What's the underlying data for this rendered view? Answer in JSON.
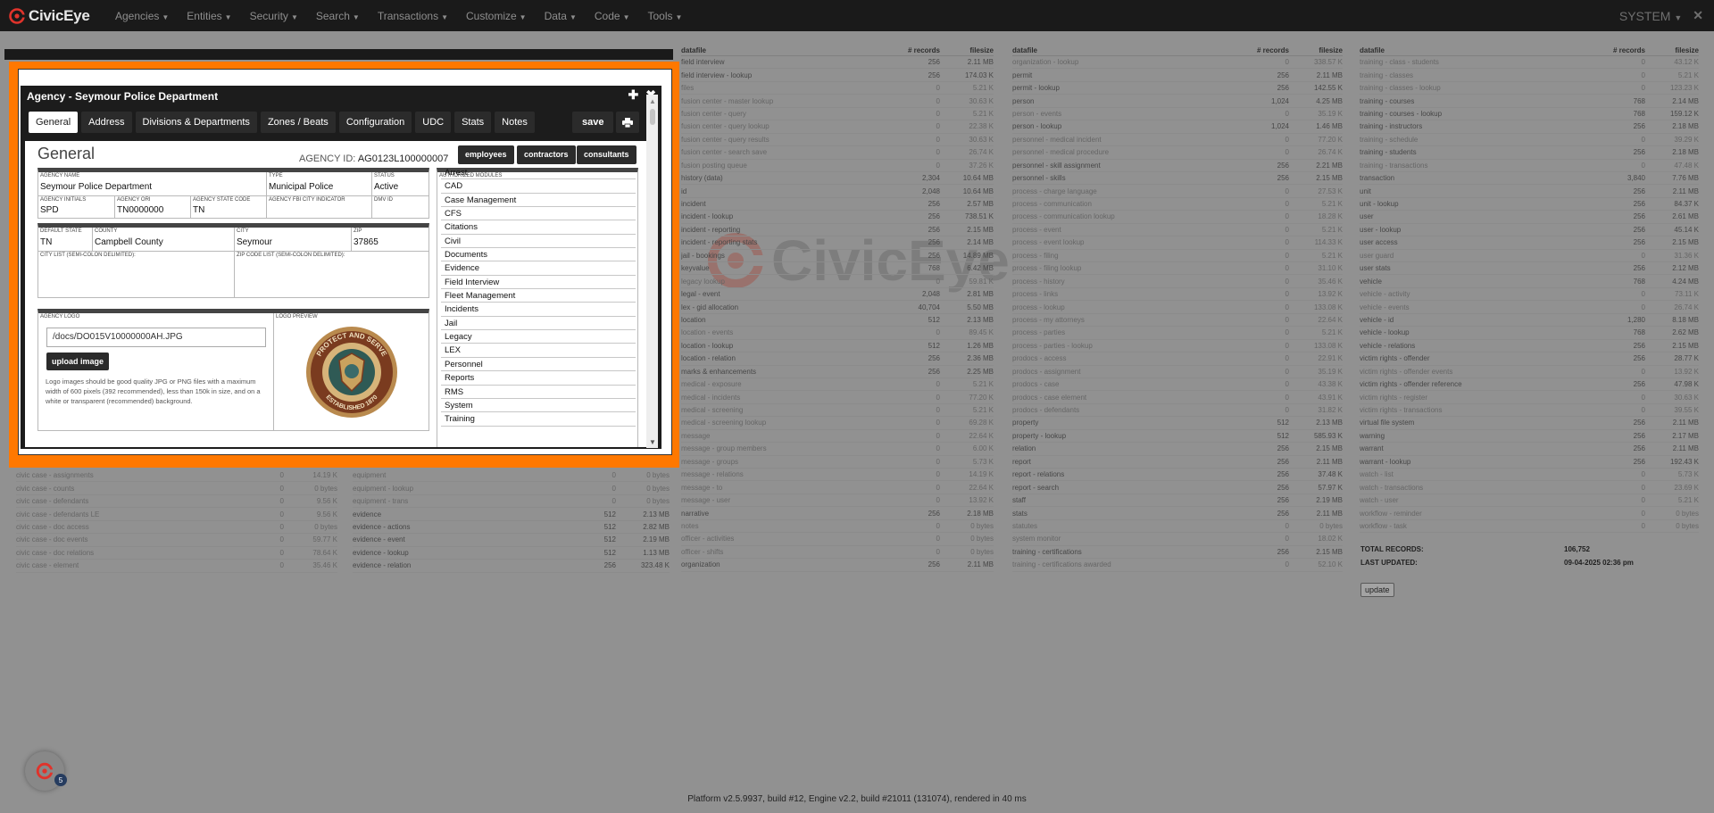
{
  "app": {
    "name": "CivicEye",
    "user": "SYSTEM",
    "brand_color": "#e0332b"
  },
  "menu": [
    "Agencies",
    "Entities",
    "Security",
    "Search",
    "Transactions",
    "Customize",
    "Data",
    "Code",
    "Tools"
  ],
  "bg_headers": {
    "datafile": "datafile",
    "records": "# records",
    "filesize": "filesize"
  },
  "bg_col1": [
    [
      "field interview",
      "256",
      "2.11 MB"
    ],
    [
      "field interview - lookup",
      "256",
      "174.03 K"
    ],
    [
      "files",
      "0",
      "5.21 K"
    ],
    [
      "fusion center - master lookup",
      "0",
      "30.63 K"
    ],
    [
      "fusion center - query",
      "0",
      "5.21 K"
    ],
    [
      "fusion center - query lookup",
      "0",
      "22.38 K"
    ],
    [
      "fusion center - query results",
      "0",
      "30.63 K"
    ],
    [
      "fusion center - search save",
      "0",
      "26.74 K"
    ],
    [
      "fusion posting queue",
      "0",
      "37.26 K"
    ],
    [
      "history (data)",
      "2,304",
      "10.64 MB"
    ],
    [
      "id",
      "2,048",
      "10.64 MB"
    ],
    [
      "incident",
      "256",
      "2.57 MB"
    ],
    [
      "incident - lookup",
      "256",
      "738.51 K"
    ],
    [
      "incident - reporting",
      "256",
      "2.15 MB"
    ],
    [
      "incident - reporting stats",
      "256",
      "2.14 MB"
    ],
    [
      "jail - bookings",
      "256",
      "14.89 MB"
    ],
    [
      "keyvalue",
      "768",
      "6.42 MB"
    ],
    [
      "legacy lookup",
      "0",
      "59.81 K"
    ],
    [
      "legal - event",
      "2,048",
      "2.81 MB"
    ],
    [
      "lex - gid allocation",
      "40,704",
      "5.50 MB"
    ],
    [
      "location",
      "512",
      "2.13 MB"
    ],
    [
      "location - events",
      "0",
      "89.45 K"
    ],
    [
      "location - lookup",
      "512",
      "1.26 MB"
    ],
    [
      "location - relation",
      "256",
      "2.36 MB"
    ],
    [
      "marks & enhancements",
      "256",
      "2.25 MB"
    ],
    [
      "medical - exposure",
      "0",
      "5.21 K"
    ],
    [
      "medical - incidents",
      "0",
      "77.20 K"
    ],
    [
      "medical - screening",
      "0",
      "5.21 K"
    ],
    [
      "medical - screening lookup",
      "0",
      "69.28 K"
    ],
    [
      "message",
      "0",
      "22.64 K"
    ],
    [
      "message - group members",
      "0",
      "6.00 K"
    ],
    [
      "message - groups",
      "0",
      "5.73 K"
    ],
    [
      "message - relations",
      "0",
      "14.19 K"
    ],
    [
      "message - to",
      "0",
      "22.64 K"
    ],
    [
      "message - user",
      "0",
      "13.92 K"
    ],
    [
      "narrative",
      "256",
      "2.18 MB"
    ],
    [
      "notes",
      "0",
      "0 bytes"
    ],
    [
      "officer - activities",
      "0",
      "0 bytes"
    ],
    [
      "officer - shifts",
      "0",
      "0 bytes"
    ],
    [
      "organization",
      "256",
      "2.11 MB"
    ]
  ],
  "bg_col2": [
    [
      "organization - lookup",
      "0",
      "338.57 K"
    ],
    [
      "permit",
      "256",
      "2.11 MB"
    ],
    [
      "permit - lookup",
      "256",
      "142.55 K"
    ],
    [
      "person",
      "1,024",
      "4.25 MB"
    ],
    [
      "person - events",
      "0",
      "35.19 K"
    ],
    [
      "person - lookup",
      "1,024",
      "1.46 MB"
    ],
    [
      "personnel - medical incident",
      "0",
      "77.20 K"
    ],
    [
      "personnel - medical procedure",
      "0",
      "26.74 K"
    ],
    [
      "personnel - skill assignment",
      "256",
      "2.21 MB"
    ],
    [
      "personnel - skills",
      "256",
      "2.15 MB"
    ],
    [
      "process - charge language",
      "0",
      "27.53 K"
    ],
    [
      "process - communication",
      "0",
      "5.21 K"
    ],
    [
      "process - communication lookup",
      "0",
      "18.28 K"
    ],
    [
      "process - event",
      "0",
      "5.21 K"
    ],
    [
      "process - event lookup",
      "0",
      "114.33 K"
    ],
    [
      "process - filing",
      "0",
      "5.21 K"
    ],
    [
      "process - filing lookup",
      "0",
      "31.10 K"
    ],
    [
      "process - history",
      "0",
      "35.46 K"
    ],
    [
      "process - links",
      "0",
      "13.92 K"
    ],
    [
      "process - lookup",
      "0",
      "133.08 K"
    ],
    [
      "process - my attorneys",
      "0",
      "22.64 K"
    ],
    [
      "process - parties",
      "0",
      "5.21 K"
    ],
    [
      "process - parties - lookup",
      "0",
      "133.08 K"
    ],
    [
      "prodocs - access",
      "0",
      "22.91 K"
    ],
    [
      "prodocs - assignment",
      "0",
      "35.19 K"
    ],
    [
      "prodocs - case",
      "0",
      "43.38 K"
    ],
    [
      "prodocs - case element",
      "0",
      "43.91 K"
    ],
    [
      "prodocs - defendants",
      "0",
      "31.82 K"
    ],
    [
      "property",
      "512",
      "2.13 MB"
    ],
    [
      "property - lookup",
      "512",
      "585.93 K"
    ],
    [
      "relation",
      "256",
      "2.15 MB"
    ],
    [
      "report",
      "256",
      "2.11 MB"
    ],
    [
      "report - relations",
      "256",
      "37.48 K"
    ],
    [
      "report - search",
      "256",
      "57.97 K"
    ],
    [
      "staff",
      "256",
      "2.19 MB"
    ],
    [
      "stats",
      "256",
      "2.11 MB"
    ],
    [
      "statutes",
      "0",
      "0 bytes"
    ],
    [
      "system monitor",
      "0",
      "18.02 K"
    ],
    [
      "training - certifications",
      "256",
      "2.15 MB"
    ],
    [
      "training - certifications awarded",
      "0",
      "52.10 K"
    ]
  ],
  "bg_col3": [
    [
      "training - class - students",
      "0",
      "43.12 K"
    ],
    [
      "training - classes",
      "0",
      "5.21 K"
    ],
    [
      "training - classes - lookup",
      "0",
      "123.23 K"
    ],
    [
      "training - courses",
      "768",
      "2.14 MB"
    ],
    [
      "training - courses - lookup",
      "768",
      "159.12 K"
    ],
    [
      "training - instructors",
      "256",
      "2.18 MB"
    ],
    [
      "training - schedule",
      "0",
      "39.29 K"
    ],
    [
      "training - students",
      "256",
      "2.18 MB"
    ],
    [
      "training - transactions",
      "0",
      "47.48 K"
    ],
    [
      "transaction",
      "3,840",
      "7.76 MB"
    ],
    [
      "unit",
      "256",
      "2.11 MB"
    ],
    [
      "unit - lookup",
      "256",
      "84.37 K"
    ],
    [
      "user",
      "256",
      "2.61 MB"
    ],
    [
      "user - lookup",
      "256",
      "45.14 K"
    ],
    [
      "user access",
      "256",
      "2.15 MB"
    ],
    [
      "user guard",
      "0",
      "31.36 K"
    ],
    [
      "user stats",
      "256",
      "2.12 MB"
    ],
    [
      "vehicle",
      "768",
      "4.24 MB"
    ],
    [
      "vehicle - activity",
      "0",
      "73.11 K"
    ],
    [
      "vehicle - events",
      "0",
      "26.74 K"
    ],
    [
      "vehicle - id",
      "1,280",
      "8.18 MB"
    ],
    [
      "vehicle - lookup",
      "768",
      "2.62 MB"
    ],
    [
      "vehicle - relations",
      "256",
      "2.15 MB"
    ],
    [
      "victim rights - offender",
      "256",
      "28.77 K"
    ],
    [
      "victim rights - offender events",
      "0",
      "13.92 K"
    ],
    [
      "victim rights - offender reference",
      "256",
      "47.98 K"
    ],
    [
      "victim rights - register",
      "0",
      "30.63 K"
    ],
    [
      "victim rights - transactions",
      "0",
      "39.55 K"
    ],
    [
      "virtual file system",
      "256",
      "2.11 MB"
    ],
    [
      "warning",
      "256",
      "2.17 MB"
    ],
    [
      "warrant",
      "256",
      "2.11 MB"
    ],
    [
      "warrant - lookup",
      "256",
      "192.43 K"
    ],
    [
      "watch - list",
      "0",
      "5.73 K"
    ],
    [
      "watch - transactions",
      "0",
      "23.69 K"
    ],
    [
      "watch - user",
      "0",
      "5.21 K"
    ],
    [
      "workflow - reminder",
      "0",
      "0 bytes"
    ],
    [
      "workflow - task",
      "0",
      "0 bytes"
    ]
  ],
  "bg_left_lower_a": [
    [
      "civic case - assignments",
      "0",
      "14.19 K"
    ],
    [
      "civic case - counts",
      "0",
      "0 bytes"
    ],
    [
      "civic case - defendants",
      "0",
      "9.56 K"
    ],
    [
      "civic case - defendants LE",
      "0",
      "9.56 K"
    ],
    [
      "civic case - doc access",
      "0",
      "0 bytes"
    ],
    [
      "civic case - doc events",
      "0",
      "59.77 K"
    ],
    [
      "civic case - doc relations",
      "0",
      "78.64 K"
    ],
    [
      "civic case - element",
      "0",
      "35.46 K"
    ]
  ],
  "bg_left_lower_b": [
    [
      "equipment",
      "0",
      "0 bytes"
    ],
    [
      "equipment - lookup",
      "0",
      "0 bytes"
    ],
    [
      "equipment - trans",
      "0",
      "0 bytes"
    ],
    [
      "evidence",
      "512",
      "2.13 MB"
    ],
    [
      "evidence - actions",
      "512",
      "2.82 MB"
    ],
    [
      "evidence - event",
      "512",
      "2.19 MB"
    ],
    [
      "evidence - lookup",
      "512",
      "1.13 MB"
    ],
    [
      "evidence - relation",
      "256",
      "323.48 K"
    ]
  ],
  "totals": {
    "records_label": "TOTAL RECORDS:",
    "records_value": "106,752",
    "updated_label": "LAST UPDATED:",
    "updated_value": "09-04-2025 02:36 pm"
  },
  "update_label": "update",
  "footer": "Platform v2.5.9937, build #12, Engine v2.2, build #21011 (131074), rendered in 40 ms",
  "notifications": "5",
  "dialog": {
    "title": "Agency - Seymour Police Department",
    "tabs": [
      "General",
      "Address",
      "Divisions & Departments",
      "Zones / Beats",
      "Configuration",
      "UDC",
      "Stats",
      "Notes"
    ],
    "save": "save",
    "section_title": "General",
    "agency_id_label": "AGENCY ID:",
    "agency_id": "AG0123L100000007",
    "buttons": {
      "employees": "employees",
      "contractors": "contractors",
      "consultants": "consultants"
    },
    "fields": {
      "agency_name_label": "AGENCY NAME",
      "agency_name": "Seymour Police Department",
      "type_label": "TYPE",
      "type": "Municipal Police",
      "status_label": "STATUS",
      "status": "Active",
      "initials_label": "AGENCY INITIALS",
      "initials": "SPD",
      "ori_label": "AGENCY ORI",
      "ori": "TN0000000",
      "state_code_label": "AGENCY STATE CODE",
      "state_code": "TN",
      "fbi_label": "AGENCY FBI CITY INDICATOR",
      "dmv_label": "DMV ID",
      "default_state_label": "DEFAULT STATE",
      "default_state": "TN",
      "county_label": "COUNTY",
      "county": "Campbell County",
      "city_label": "CITY",
      "city": "Seymour",
      "zip_label": "ZIP",
      "zip": "37865",
      "city_list_label": "CITY LIST (SEMI-COLON DELIMITED):",
      "zip_list_label": "ZIP CODE LIST (SEMI-COLON DELIMITED):"
    },
    "logo": {
      "label": "AGENCY LOGO",
      "preview_label": "LOGO PREVIEW",
      "path": "/docs/DO015V10000000AH.JPG",
      "upload": "upload image",
      "note": "Logo images should be good quality JPG or PNG files with a maximum width of 600 pixels (392 recommended), less than 150k in size, and on a white or transparent (recommended) background.",
      "badge_top": "PROTECT AND SERVE",
      "badge_bottom": "ESTABLISHED 1870"
    },
    "modules_label": "AUTHORIZED MODULES",
    "modules": [
      "Arrest",
      "CAD",
      "Case Management",
      "CFS",
      "Citations",
      "Civil",
      "Documents",
      "Evidence",
      "Field Interview",
      "Fleet Management",
      "Incidents",
      "Jail",
      "Legacy",
      "LEX",
      "Personnel",
      "Reports",
      "RMS",
      "System",
      "Training"
    ]
  }
}
